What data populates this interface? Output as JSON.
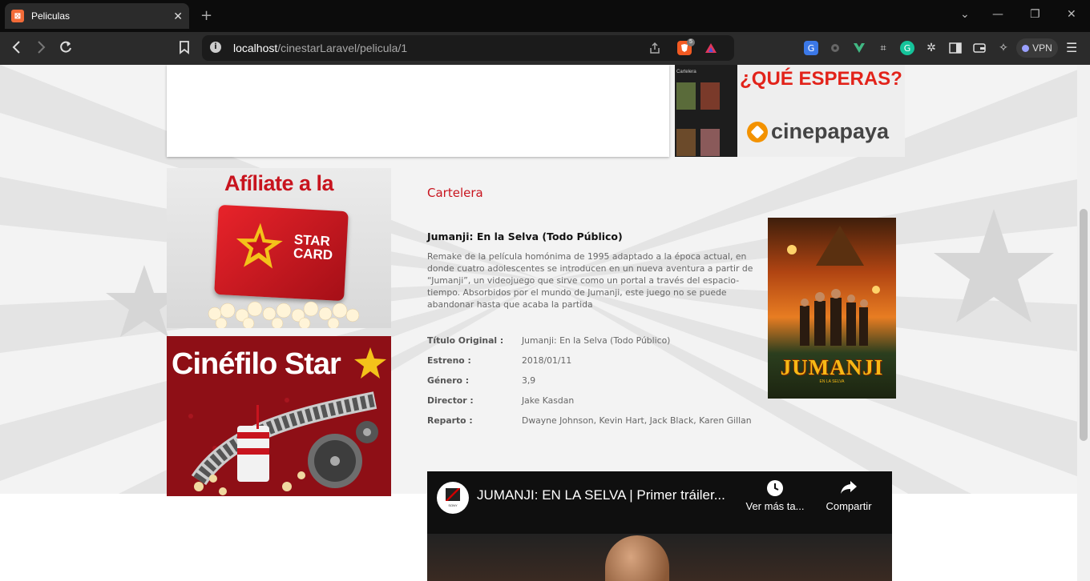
{
  "browser": {
    "tab_title": "Peliculas",
    "tab_close": "✕",
    "new_tab": "+",
    "url_host": "localhost",
    "url_path": "/cinestarLaravel/pelicula/1",
    "vpn_label": "VPN",
    "window_controls": [
      "⌄",
      "—",
      "❐",
      "✕"
    ],
    "brave_badge": "5"
  },
  "ads": {
    "top_headline": "¿QUÉ ESPERAS?",
    "top_brand": "cinepapaya",
    "top_phone_label": "Cartelera",
    "starcard_title": "Afíliate a la",
    "starcard_card_line1": "STAR",
    "starcard_card_line2": "CARD",
    "cinefilo_title": "Cinéfilo Star"
  },
  "section": {
    "title": "Cartelera"
  },
  "movie": {
    "title": "Jumanji: En la Selva (Todo Público)",
    "synopsis": "Remake de la película homónima de 1995 adaptado a la época actual, en donde cuatro adolescentes se introducen en un nueva aventura a partir de “Jumanji”, un videojuego que sirve como un portal a través del espacio-tiempo. Absorbidos por el mundo de Jumanji, este juego no se puede abandonar hasta que acaba la partida",
    "details": [
      {
        "label": "Título Original :",
        "value": "Jumanji: En la Selva (Todo Público)"
      },
      {
        "label": "Estreno :",
        "value": "2018/01/11"
      },
      {
        "label": "Género :",
        "value": "3,9"
      },
      {
        "label": "Director :",
        "value": "Jake Kasdan"
      },
      {
        "label": "Reparto :",
        "value": "Dwayne Johnson, Kevin Hart, Jack Black, Karen Gillan"
      }
    ],
    "poster_title": "JUMANJI",
    "poster_subtitle": "EN LA SELVA"
  },
  "video": {
    "title": "JUMANJI: EN LA SELVA | Primer tráiler...",
    "watch_later": "Ver más ta...",
    "share": "Compartir",
    "channel_logo_text": "SONY"
  },
  "colors": {
    "accent_red": "#c8141e",
    "chrome_dark": "#2b2b2b"
  }
}
